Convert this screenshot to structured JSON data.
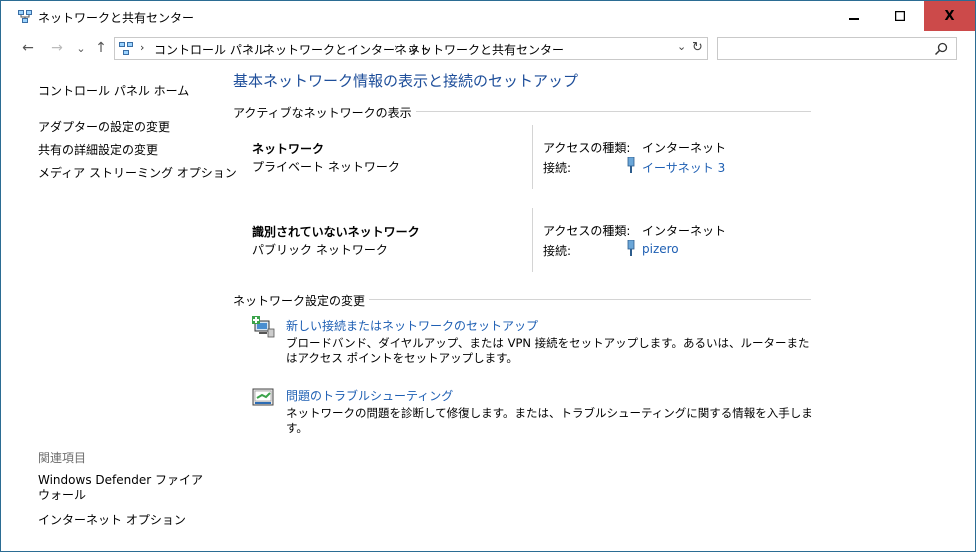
{
  "window": {
    "title": "ネットワークと共有センター",
    "controls": {
      "minimize": "–",
      "maximize": "□",
      "close": "X"
    }
  },
  "nav": {
    "back": "←",
    "forward": "→",
    "recent": "⌄",
    "up": "↑",
    "breadcrumb": [
      "コントロール パネル",
      "ネットワークとインターネット",
      "ネットワークと共有センター"
    ],
    "dropdown": "⌄",
    "refresh": "↻",
    "search_placeholder": ""
  },
  "sidebar": {
    "home": "コントロール パネル ホーム",
    "links": [
      "アダプターの設定の変更",
      "共有の詳細設定の変更",
      "メディア ストリーミング オプション"
    ],
    "related_header": "関連項目",
    "related": [
      "Windows Defender ファイアウォール",
      "インターネット オプション"
    ]
  },
  "main": {
    "title": "基本ネットワーク情報の表示と接続のセットアップ",
    "active_header": "アクティブなネットワークの表示",
    "networks": [
      {
        "name": "ネットワーク",
        "category": "プライベート ネットワーク",
        "access_label": "アクセスの種類:",
        "access_value": "インターネット",
        "conn_label": "接続:",
        "conn_value": "イーサネット 3"
      },
      {
        "name": "識別されていないネットワーク",
        "category": "パブリック ネットワーク",
        "access_label": "アクセスの種類:",
        "access_value": "インターネット",
        "conn_label": "接続:",
        "conn_value": "pizero"
      }
    ],
    "change_header": "ネットワーク設定の変更",
    "tasks": [
      {
        "title": "新しい接続またはネットワークのセットアップ",
        "desc": "ブロードバンド、ダイヤルアップ、または VPN 接続をセットアップします。あるいは、ルーターまたはアクセス ポイントをセットアップします。"
      },
      {
        "title": "問題のトラブルシューティング",
        "desc": "ネットワークの問題を診断して修復します。または、トラブルシューティングに関する情報を入手します。"
      }
    ]
  }
}
